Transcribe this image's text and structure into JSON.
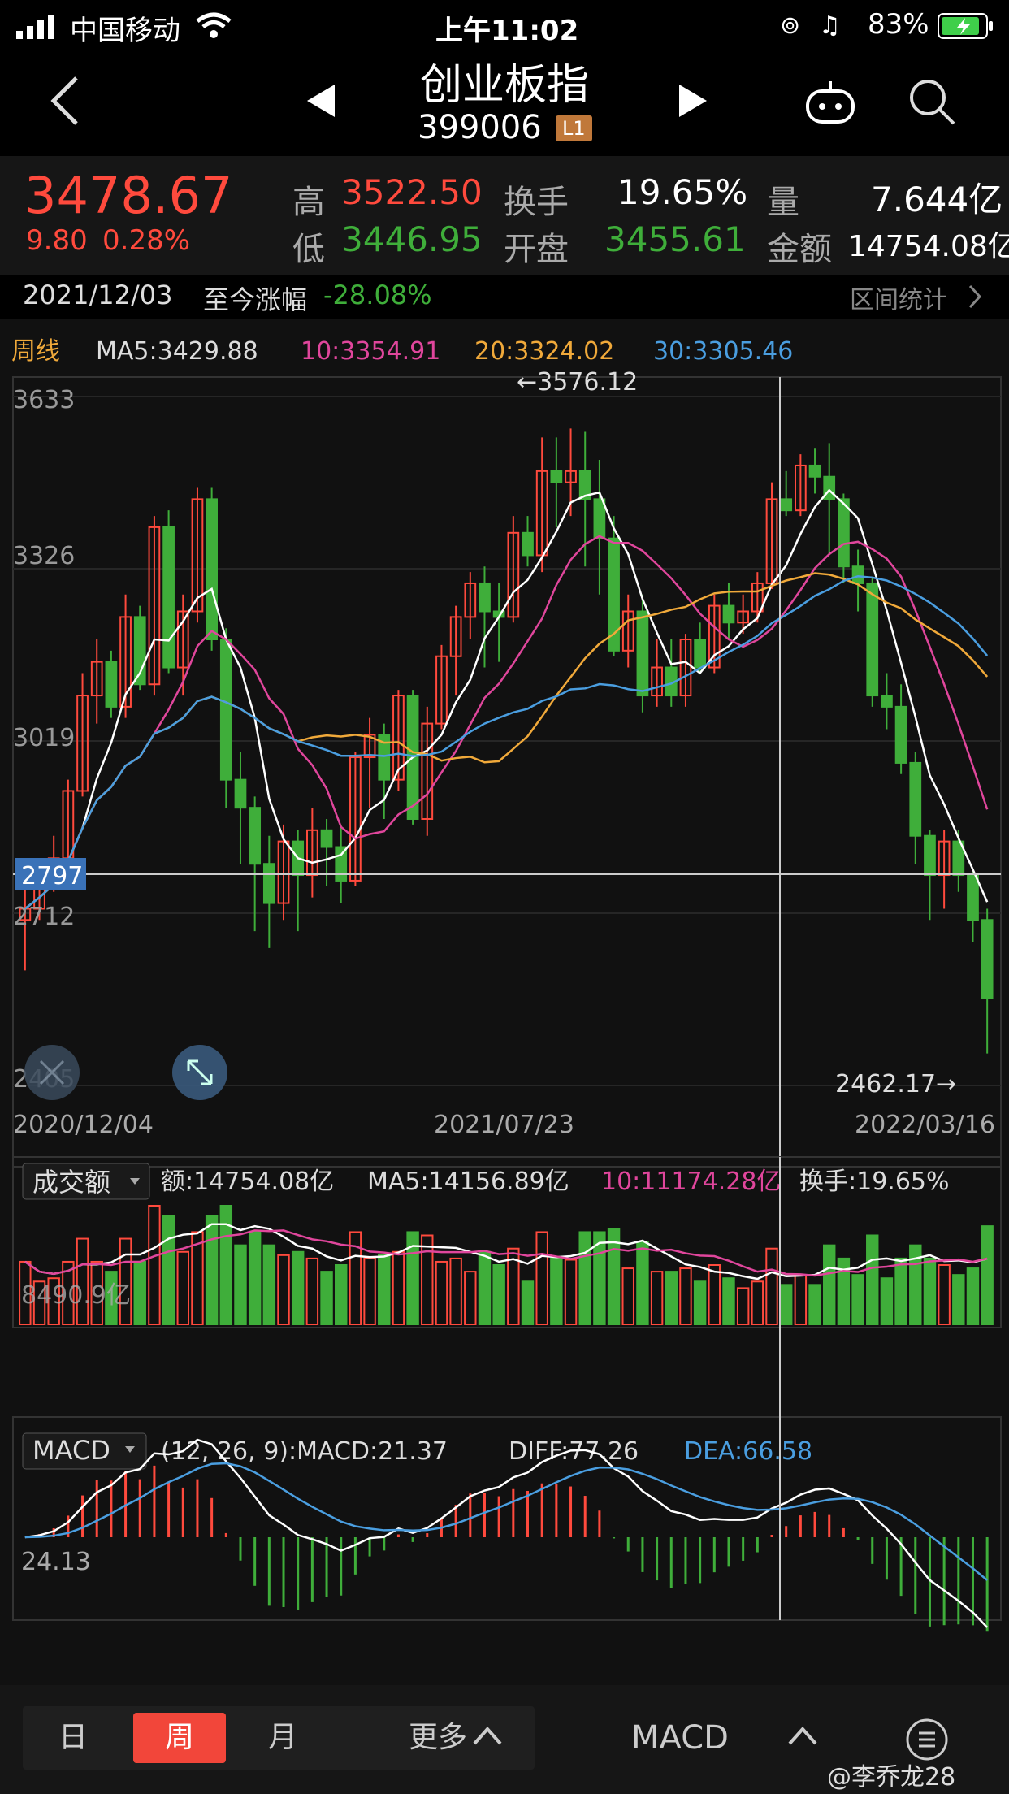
{
  "status": {
    "carrier": "中国移动",
    "time": "上午11:02",
    "battery": "83%"
  },
  "header": {
    "title": "创业板指",
    "code": "399006",
    "level_badge": "L1",
    "icons": [
      "back-arrow-icon",
      "prev-triangle-icon",
      "next-triangle-icon",
      "robot-icon",
      "search-icon"
    ]
  },
  "quote": {
    "price": "3478.67",
    "change": "9.80",
    "change_pct": "0.28%",
    "high_label": "高",
    "high": "3522.50",
    "low_label": "低",
    "low": "3446.95",
    "turnover_label": "换手",
    "turnover": "19.65%",
    "open_label": "开盘",
    "open": "3455.61",
    "volume_label": "量",
    "volume": "7.644亿",
    "amount_label": "金额",
    "amount": "14754.08亿",
    "colors": {
      "up": "#ff4a3d",
      "down": "#3fae3a"
    }
  },
  "range": {
    "date": "2021/12/03",
    "label": "至今涨幅",
    "value": "-28.08%",
    "stats_label": "区间统计"
  },
  "kline": {
    "period_label": "周线",
    "ma5": "MA5:3429.88",
    "ma10": "10:3354.91",
    "ma20": "20:3324.02",
    "ma30": "30:3305.46",
    "colors": {
      "ma5": "#ffffff",
      "ma10": "#e0469c",
      "ma20": "#f0a93a",
      "ma30": "#4a9ee0"
    },
    "y_ticks": [
      "3633",
      "3326",
      "3019",
      "2712",
      "2405"
    ],
    "x_labels": [
      "2020/12/04",
      "2021/07/23",
      "2022/03/16"
    ],
    "cursor_value": "2797",
    "max_annotation": "←3576.12",
    "min_annotation": "2462.17→"
  },
  "volume": {
    "selector": "成交额",
    "amount": "额:14754.08亿",
    "ma5": "MA5:14156.89亿",
    "ma10": "10:11174.28亿",
    "turnover": "换手:19.65%",
    "axis_label": "8490.9亿"
  },
  "macd": {
    "selector": "MACD",
    "params": "(12, 26, 9):MACD:21.37",
    "diff": "DIFF:77.26",
    "dea": "DEA:66.58",
    "axis_label": "24.13"
  },
  "tabs": {
    "day": "日",
    "week": "周",
    "month": "月",
    "more": "更多",
    "indicator": "MACD",
    "watermark": "@李乔龙28"
  },
  "chart_data": {
    "type": "candlestick",
    "period": "weekly",
    "x_range": [
      "2020/12/04",
      "2022/03/16"
    ],
    "ylim": [
      2405,
      3633
    ],
    "y_ticks": [
      3633,
      3326,
      3019,
      2712,
      2405
    ],
    "series": [
      {
        "name": "MA5",
        "value": 3429.88
      },
      {
        "name": "10",
        "value": 3354.91
      },
      {
        "name": "20",
        "value": 3324.02
      },
      {
        "name": "30",
        "value": 3305.46
      }
    ],
    "candles": [
      [
        2700,
        2720,
        2610,
        2760
      ],
      [
        2720,
        2760,
        2700,
        2790
      ],
      [
        2760,
        2810,
        2750,
        2850
      ],
      [
        2810,
        2930,
        2800,
        2950
      ],
      [
        2930,
        3100,
        2920,
        3140
      ],
      [
        3100,
        3160,
        3050,
        3200
      ],
      [
        3160,
        3080,
        3060,
        3180
      ],
      [
        3080,
        3240,
        3060,
        3280
      ],
      [
        3240,
        3120,
        3110,
        3260
      ],
      [
        3120,
        3400,
        3100,
        3420
      ],
      [
        3400,
        3150,
        3140,
        3430
      ],
      [
        3150,
        3250,
        3100,
        3280
      ],
      [
        3250,
        3450,
        3230,
        3470
      ],
      [
        3450,
        3200,
        3180,
        3470
      ],
      [
        3200,
        2950,
        2900,
        3220
      ],
      [
        2950,
        2900,
        2800,
        3000
      ],
      [
        2900,
        2800,
        2680,
        2920
      ],
      [
        2800,
        2730,
        2650,
        2850
      ],
      [
        2730,
        2840,
        2700,
        2870
      ],
      [
        2840,
        2780,
        2680,
        2860
      ],
      [
        2780,
        2860,
        2740,
        2900
      ],
      [
        2860,
        2830,
        2760,
        2880
      ],
      [
        2830,
        2770,
        2730,
        2870
      ],
      [
        2770,
        2990,
        2760,
        3000
      ],
      [
        2990,
        3030,
        2900,
        3060
      ],
      [
        3030,
        2950,
        2880,
        3050
      ],
      [
        2950,
        3100,
        2930,
        3110
      ],
      [
        3100,
        2880,
        2870,
        3110
      ],
      [
        2880,
        3050,
        2850,
        3080
      ],
      [
        3050,
        3170,
        3040,
        3190
      ],
      [
        3170,
        3240,
        3100,
        3260
      ],
      [
        3240,
        3300,
        3200,
        3320
      ],
      [
        3300,
        3250,
        3150,
        3330
      ],
      [
        3250,
        3240,
        3160,
        3300
      ],
      [
        3240,
        3390,
        3230,
        3420
      ],
      [
        3390,
        3350,
        3330,
        3420
      ],
      [
        3350,
        3500,
        3320,
        3560
      ],
      [
        3500,
        3480,
        3400,
        3560
      ],
      [
        3480,
        3500,
        3420,
        3576
      ],
      [
        3500,
        3450,
        3330,
        3570
      ],
      [
        3450,
        3380,
        3280,
        3520
      ],
      [
        3380,
        3180,
        3170,
        3420
      ],
      [
        3180,
        3250,
        3150,
        3280
      ],
      [
        3250,
        3100,
        3070,
        3280
      ],
      [
        3100,
        3150,
        3080,
        3200
      ],
      [
        3150,
        3100,
        3080,
        3200
      ],
      [
        3100,
        3200,
        3080,
        3210
      ],
      [
        3200,
        3150,
        3140,
        3230
      ],
      [
        3150,
        3260,
        3140,
        3280
      ],
      [
        3260,
        3230,
        3200,
        3300
      ],
      [
        3230,
        3250,
        3210,
        3280
      ],
      [
        3250,
        3300,
        3230,
        3320
      ],
      [
        3300,
        3450,
        3290,
        3480
      ],
      [
        3450,
        3430,
        3420,
        3500
      ],
      [
        3430,
        3510,
        3420,
        3530
      ],
      [
        3510,
        3490,
        3460,
        3540
      ],
      [
        3490,
        3450,
        3350,
        3550
      ],
      [
        3450,
        3330,
        3300,
        3460
      ],
      [
        3330,
        3300,
        3250,
        3360
      ],
      [
        3300,
        3100,
        3080,
        3310
      ],
      [
        3100,
        3080,
        3040,
        3140
      ],
      [
        3080,
        2980,
        2960,
        3120
      ],
      [
        2980,
        2850,
        2800,
        3000
      ],
      [
        2850,
        2780,
        2700,
        2860
      ],
      [
        2780,
        2840,
        2720,
        2860
      ],
      [
        2840,
        2780,
        2750,
        2860
      ],
      [
        2780,
        2700,
        2660,
        2790
      ],
      [
        2700,
        2560,
        2462,
        2720
      ]
    ]
  }
}
